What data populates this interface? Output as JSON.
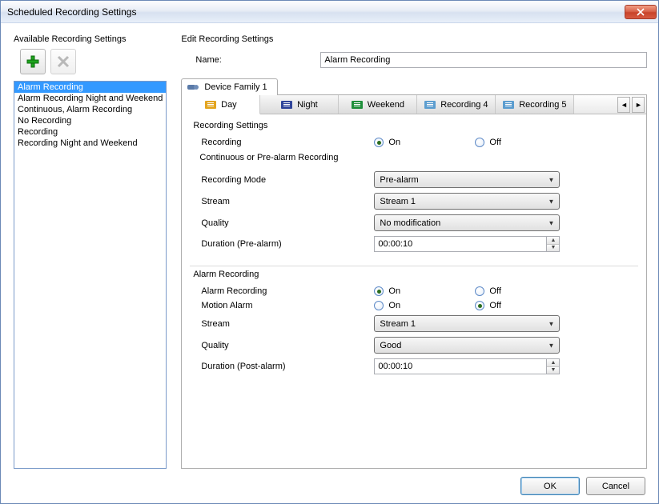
{
  "window": {
    "title": "Scheduled Recording Settings"
  },
  "left": {
    "heading": "Available Recording Settings",
    "items": [
      "Alarm Recording",
      "Alarm Recording Night and Weekend",
      "Continuous, Alarm Recording",
      "No Recording",
      "Recording",
      "Recording Night and Weekend"
    ],
    "selected_index": 0
  },
  "right": {
    "heading": "Edit Recording Settings",
    "name_label": "Name:",
    "name_value": "Alarm Recording",
    "device_tab": "Device Family 1",
    "rec_tabs": [
      "Day",
      "Night",
      "Weekend",
      "Recording 4",
      "Recording 5"
    ],
    "rec_tab_active_index": 0,
    "groups": {
      "recording_settings_title": "Recording Settings",
      "recording_label": "Recording",
      "recording_value": "On",
      "continuous_title": "Continuous or Pre-alarm Recording",
      "mode_label": "Recording Mode",
      "mode_value": "Pre-alarm",
      "stream_label": "Stream",
      "stream_value": "Stream 1",
      "quality_label": "Quality",
      "quality_value": "No modification",
      "duration_pre_label": "Duration (Pre-alarm)",
      "duration_pre_value": "00:00:10",
      "alarm_title": "Alarm Recording",
      "alarm_rec_label": "Alarm Recording",
      "alarm_rec_value": "On",
      "motion_label": "Motion Alarm",
      "motion_value": "Off",
      "alarm_stream_label": "Stream",
      "alarm_stream_value": "Stream 1",
      "alarm_quality_label": "Quality",
      "alarm_quality_value": "Good",
      "duration_post_label": "Duration (Post-alarm)",
      "duration_post_value": "00:00:10"
    },
    "radio": {
      "on": "On",
      "off": "Off"
    }
  },
  "buttons": {
    "ok": "OK",
    "cancel": "Cancel"
  }
}
